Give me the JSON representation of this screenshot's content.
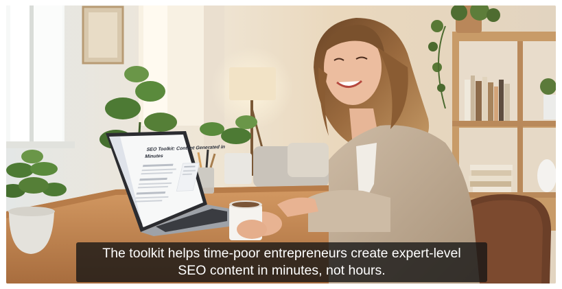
{
  "caption": {
    "line1": "The toolkit helps time-poor entrepreneurs create expert-level",
    "line2": "SEO content in minutes, not hours."
  },
  "laptop_screen": {
    "title_line1": "SEO Toolkit: Content Generated in",
    "title_line2": "Minutes"
  },
  "colors": {
    "caption_bg": "#141414",
    "caption_text": "#ffffff",
    "wall": "#e9ddcb",
    "table": "#c58a55"
  }
}
